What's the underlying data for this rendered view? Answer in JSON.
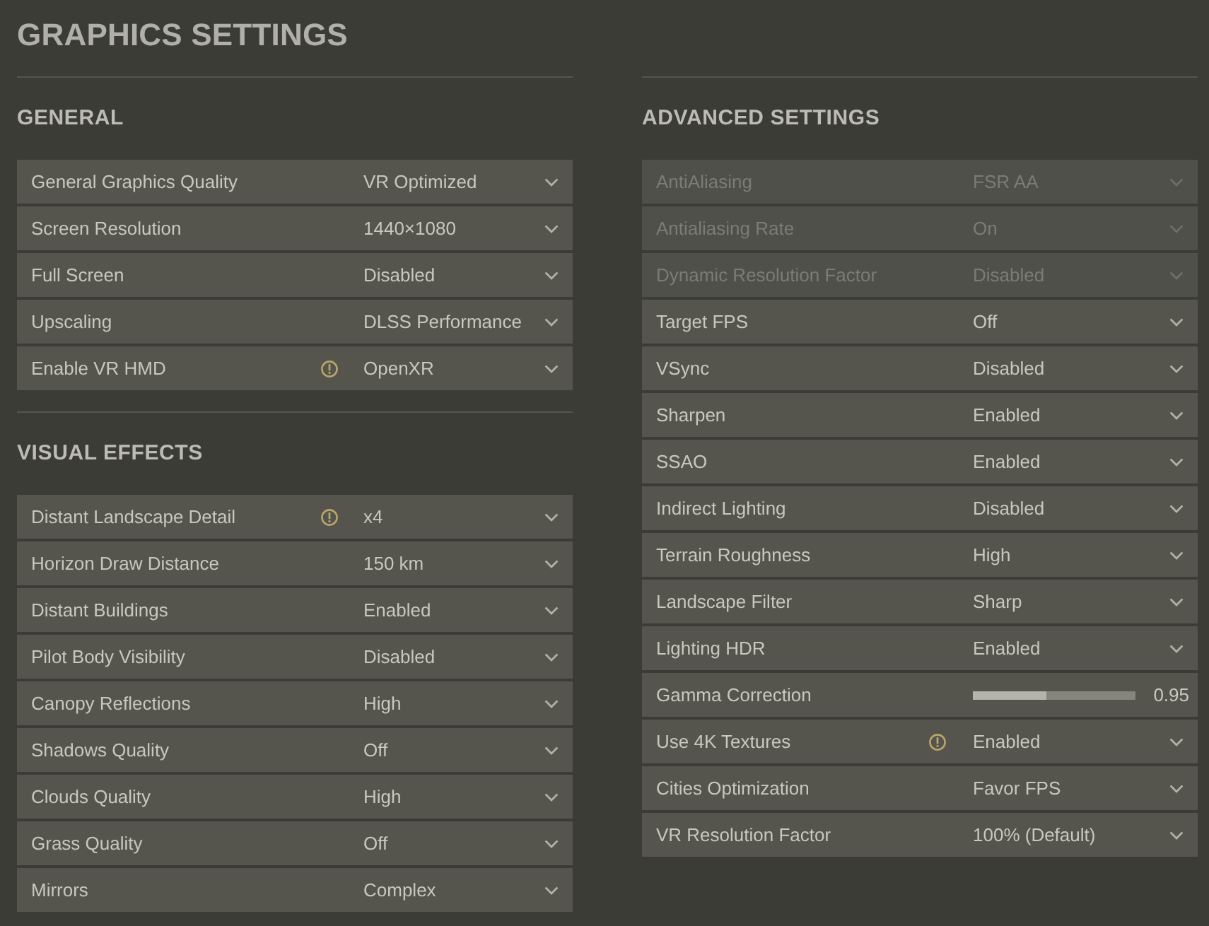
{
  "title": "GRAPHICS SETTINGS",
  "columns": [
    {
      "sections": [
        {
          "heading": "GENERAL",
          "rows": [
            {
              "kind": "dropdown",
              "label": "General Graphics Quality",
              "value": "VR Optimized",
              "warning": false,
              "disabled": false
            },
            {
              "kind": "dropdown",
              "label": "Screen Resolution",
              "value": "1440×1080",
              "warning": false,
              "disabled": false
            },
            {
              "kind": "dropdown",
              "label": "Full Screen",
              "value": "Disabled",
              "warning": false,
              "disabled": false
            },
            {
              "kind": "dropdown",
              "label": "Upscaling",
              "value": "DLSS Performance",
              "warning": false,
              "disabled": false
            },
            {
              "kind": "dropdown",
              "label": "Enable VR HMD",
              "value": "OpenXR",
              "warning": true,
              "disabled": false
            }
          ]
        },
        {
          "heading": "VISUAL EFFECTS",
          "rows": [
            {
              "kind": "dropdown",
              "label": "Distant Landscape Detail",
              "value": "x4",
              "warning": true,
              "disabled": false
            },
            {
              "kind": "dropdown",
              "label": "Horizon Draw Distance",
              "value": "150 km",
              "warning": false,
              "disabled": false
            },
            {
              "kind": "dropdown",
              "label": "Distant Buildings",
              "value": "Enabled",
              "warning": false,
              "disabled": false
            },
            {
              "kind": "dropdown",
              "label": "Pilot Body Visibility",
              "value": "Disabled",
              "warning": false,
              "disabled": false
            },
            {
              "kind": "dropdown",
              "label": "Canopy Reflections",
              "value": "High",
              "warning": false,
              "disabled": false
            },
            {
              "kind": "dropdown",
              "label": "Shadows Quality",
              "value": "Off",
              "warning": false,
              "disabled": false
            },
            {
              "kind": "dropdown",
              "label": "Clouds Quality",
              "value": "High",
              "warning": false,
              "disabled": false
            },
            {
              "kind": "dropdown",
              "label": "Grass Quality",
              "value": "Off",
              "warning": false,
              "disabled": false
            },
            {
              "kind": "dropdown",
              "label": "Mirrors",
              "value": "Complex",
              "warning": false,
              "disabled": false
            }
          ]
        }
      ]
    },
    {
      "sections": [
        {
          "heading": "ADVANCED SETTINGS",
          "rows": [
            {
              "kind": "dropdown",
              "label": "AntiAliasing",
              "value": "FSR AA",
              "warning": false,
              "disabled": true
            },
            {
              "kind": "dropdown",
              "label": "Antialiasing Rate",
              "value": "On",
              "warning": false,
              "disabled": true
            },
            {
              "kind": "dropdown",
              "label": "Dynamic Resolution Factor",
              "value": "Disabled",
              "warning": false,
              "disabled": true
            },
            {
              "kind": "dropdown",
              "label": "Target FPS",
              "value": "Off",
              "warning": false,
              "disabled": false
            },
            {
              "kind": "dropdown",
              "label": "VSync",
              "value": "Disabled",
              "warning": false,
              "disabled": false
            },
            {
              "kind": "dropdown",
              "label": "Sharpen",
              "value": "Enabled",
              "warning": false,
              "disabled": false
            },
            {
              "kind": "dropdown",
              "label": "SSAO",
              "value": "Enabled",
              "warning": false,
              "disabled": false
            },
            {
              "kind": "dropdown",
              "label": "Indirect Lighting",
              "value": "Disabled",
              "warning": false,
              "disabled": false
            },
            {
              "kind": "dropdown",
              "label": "Terrain Roughness",
              "value": "High",
              "warning": false,
              "disabled": false
            },
            {
              "kind": "dropdown",
              "label": "Landscape Filter",
              "value": "Sharp",
              "warning": false,
              "disabled": false
            },
            {
              "kind": "dropdown",
              "label": "Lighting HDR",
              "value": "Enabled",
              "warning": false,
              "disabled": false
            },
            {
              "kind": "slider",
              "label": "Gamma Correction",
              "level": 0.45,
              "reading": "0.95",
              "warning": false,
              "disabled": false
            },
            {
              "kind": "dropdown",
              "label": "Use 4K Textures",
              "value": "Enabled",
              "warning": true,
              "disabled": false
            },
            {
              "kind": "dropdown",
              "label": "Cities Optimization",
              "value": "Favor FPS",
              "warning": false,
              "disabled": false
            },
            {
              "kind": "dropdown",
              "label": "VR Resolution Factor",
              "value": "100% (Default)",
              "warning": false,
              "disabled": false
            }
          ]
        }
      ]
    }
  ]
}
